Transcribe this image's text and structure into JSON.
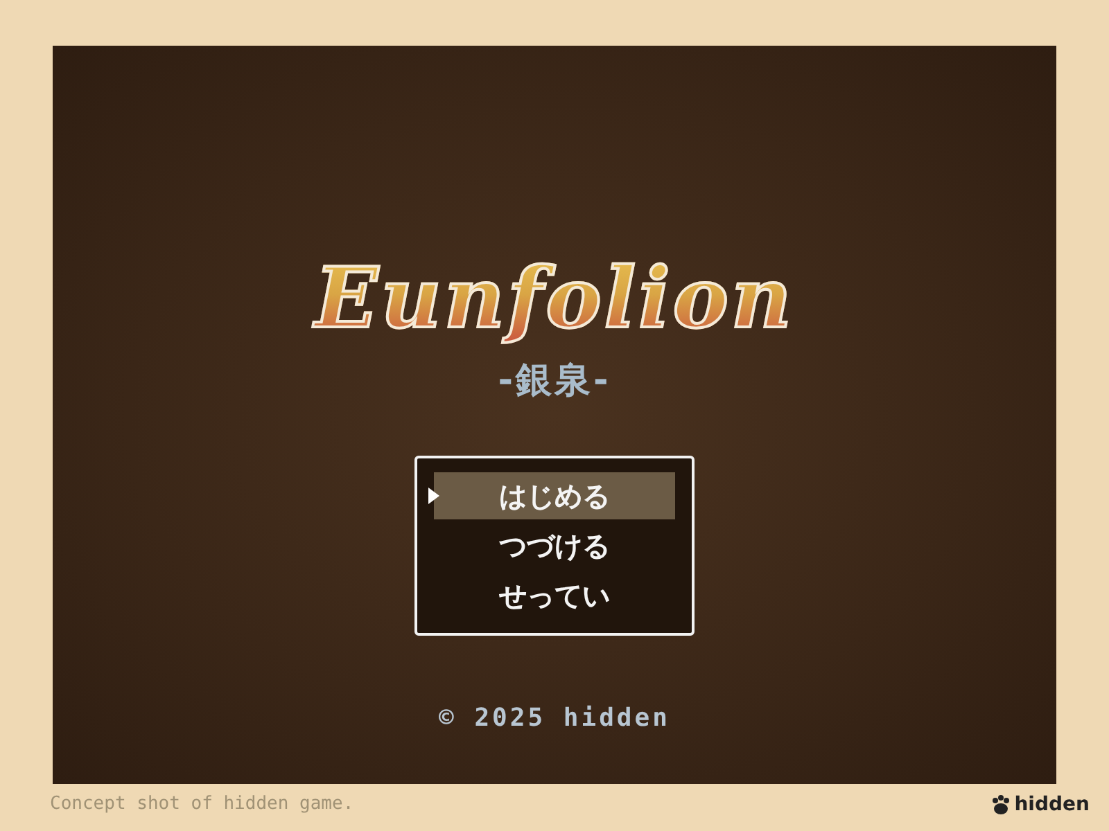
{
  "game_screen": {
    "title": "Eunfolion",
    "subtitle": "-銀泉-",
    "menu": [
      {
        "label": "はじめる",
        "selected": true
      },
      {
        "label": "つづける",
        "selected": false
      },
      {
        "label": "せってい",
        "selected": false
      }
    ],
    "copyright": "© 2025 hidden"
  },
  "caption": "Concept shot of hidden game.",
  "credit": "hidden"
}
